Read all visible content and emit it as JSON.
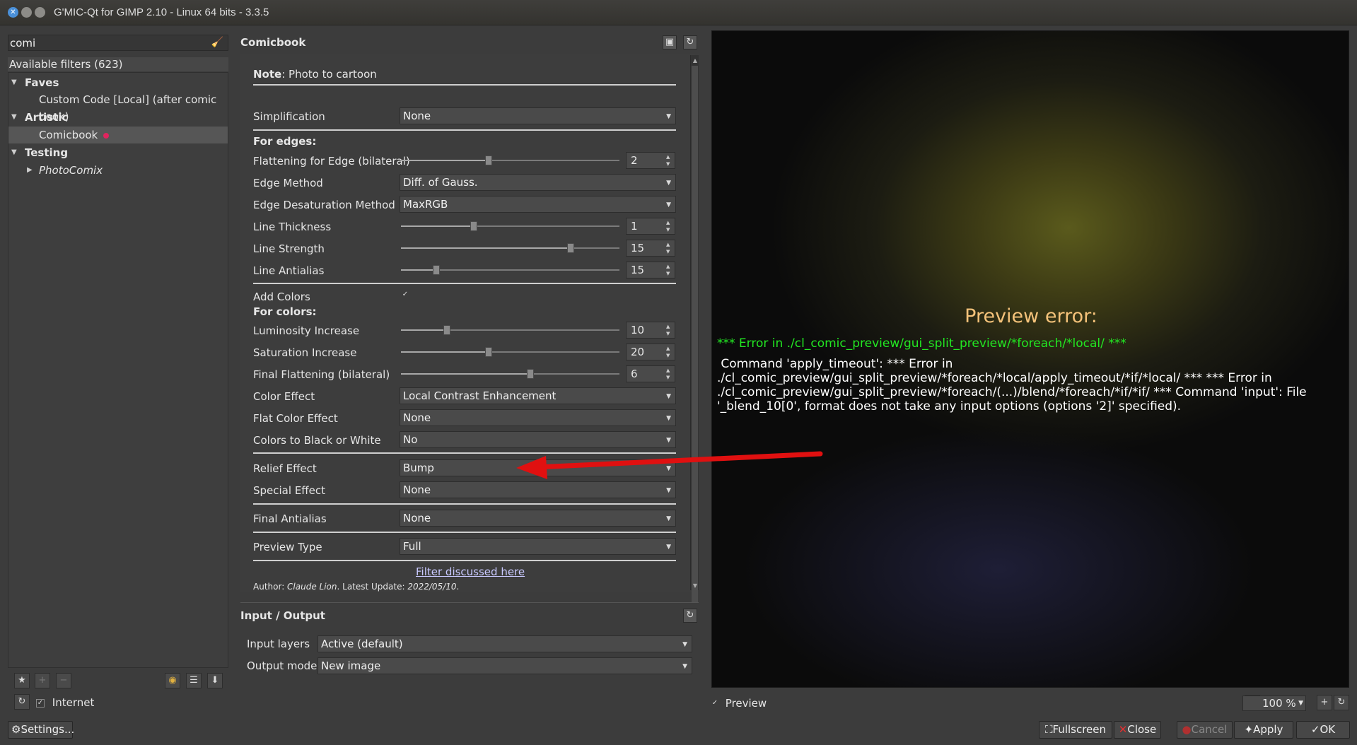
{
  "window": {
    "title": "G'MIC-Qt for GIMP 2.10 - Linux 64 bits - 3.3.5"
  },
  "left": {
    "search_value": "comi",
    "available": "Available filters (623)",
    "tree": [
      {
        "label": "Faves",
        "type": "category"
      },
      {
        "label": "Custom Code [Local] (after comic book)",
        "type": "filter"
      },
      {
        "label": "Artistic",
        "type": "category"
      },
      {
        "label": "Comicbook",
        "type": "filter",
        "selected": true
      },
      {
        "label": "Testing",
        "type": "category"
      },
      {
        "label": "PhotoComix",
        "type": "subfolder"
      }
    ],
    "internet_label": "Internet",
    "settings_label": "Settings..."
  },
  "filter": {
    "title": "Comicbook",
    "note_bold": "Note",
    "note_text": ": Photo to cartoon",
    "params": {
      "simplification": {
        "label": "Simplification",
        "value": "None"
      },
      "for_edges": "For edges:",
      "flattening_edge": {
        "label": "Flattening for Edge (bilateral)",
        "value": "2"
      },
      "edge_method": {
        "label": "Edge Method",
        "value": "Diff. of Gauss."
      },
      "edge_desat": {
        "label": "Edge Desaturation Method",
        "value": "MaxRGB"
      },
      "line_thickness": {
        "label": "Line Thickness",
        "value": "1"
      },
      "line_strength": {
        "label": "Line Strength",
        "value": "15"
      },
      "line_antialias": {
        "label": "Line Antialias",
        "value": "15"
      },
      "add_colors": {
        "label": "Add Colors",
        "checked": true
      },
      "for_colors": "For colors:",
      "luminosity": {
        "label": "Luminosity Increase",
        "value": "10"
      },
      "saturation": {
        "label": "Saturation Increase",
        "value": "20"
      },
      "final_flattening": {
        "label": "Final Flattening (bilateral)",
        "value": "6"
      },
      "color_effect": {
        "label": "Color Effect",
        "value": "Local Contrast Enhancement"
      },
      "flat_color": {
        "label": "Flat Color Effect",
        "value": "None"
      },
      "colors_bw": {
        "label": "Colors to Black or White",
        "value": "No"
      },
      "relief": {
        "label": "Relief Effect",
        "value": "Bump"
      },
      "special": {
        "label": "Special Effect",
        "value": "None"
      },
      "final_antialias": {
        "label": "Final Antialias",
        "value": "None"
      },
      "preview_type": {
        "label": "Preview Type",
        "value": "Full"
      }
    },
    "link": "Filter discussed here",
    "author_prefix": "Author: ",
    "author_name": "Claude Lion",
    "author_mid": ". Latest Update: ",
    "author_date": "2022/05/10",
    "author_end": "."
  },
  "io": {
    "title": "Input / Output",
    "input_label": "Input layers",
    "input_value": "Active (default)",
    "output_label": "Output mode",
    "output_value": "New image"
  },
  "preview": {
    "error_title": "Preview error:",
    "error_green": "*** Error in ./cl_comic_preview/gui_split_preview/*foreach/*local/ ***",
    "error_text": " Command 'apply_timeout': *** Error in ./cl_comic_preview/gui_split_preview/*foreach/*local/apply_timeout/*if/*local/ *** *** Error in ./cl_comic_preview/gui_split_preview/*foreach/(...)/blend/*foreach/*if/*if/ *** Command 'input': File '_blend_10[0', format does not take any input options (options '2]' specified).",
    "preview_label": "Preview",
    "zoom": "100 %"
  },
  "buttons": {
    "fullscreen": "Fullscreen",
    "close": "Close",
    "cancel": "Cancel",
    "apply": "Apply",
    "ok": "OK"
  },
  "colors": {
    "error_title": "#f4c27a",
    "error_green": "#22e622",
    "arrow": "#e01010",
    "fave_dot": "#e0245e"
  }
}
